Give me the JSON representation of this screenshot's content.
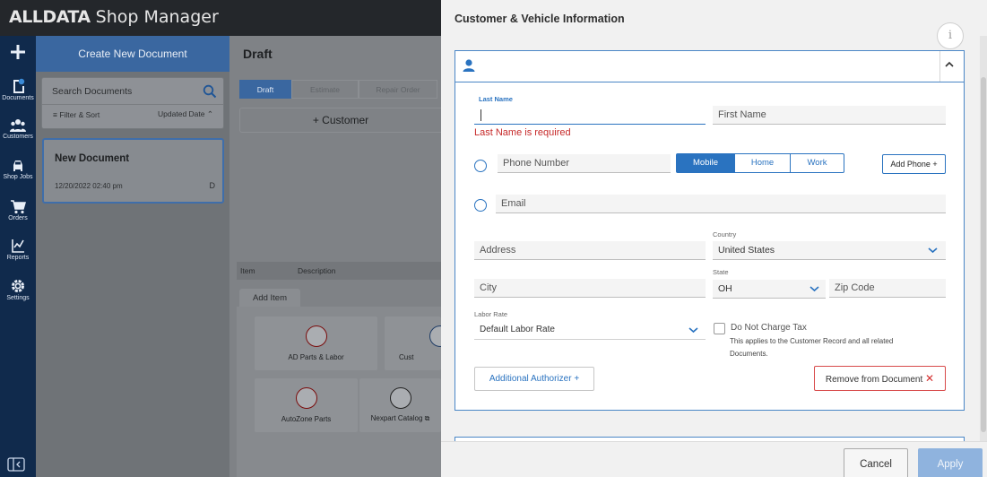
{
  "app": {
    "brand_bold": "ALLDATA",
    "brand_rest": " Shop Manager"
  },
  "nav": {
    "items": [
      {
        "label": "Documents",
        "icon": "documents-icon"
      },
      {
        "label": "Customers",
        "icon": "customers-icon"
      },
      {
        "label": "Shop Jobs",
        "icon": "car-icon"
      },
      {
        "label": "Orders",
        "icon": "cart-icon"
      },
      {
        "label": "Reports",
        "icon": "reports-icon"
      },
      {
        "label": "Settings",
        "icon": "gear-icon"
      }
    ]
  },
  "documents": {
    "create_label": "Create New Document",
    "search_placeholder": "Search Documents",
    "filter_label": "Filter & Sort",
    "sort_label": "Updated Date",
    "card": {
      "title": "New Document",
      "date": "12/20/2022 02:40 pm",
      "status": "D"
    }
  },
  "draft": {
    "title": "Draft",
    "tabs": [
      "Draft",
      "Estimate",
      "Repair Order"
    ],
    "customer_button": "Customer",
    "table_headers": [
      "Item",
      "Description"
    ],
    "add_item_tab": "Add Item",
    "tiles": [
      "AD Parts & Labor",
      "AutoZone Parts",
      "Nexpart Catalog",
      "Cust"
    ]
  },
  "panel": {
    "title": "Customer & Vehicle Information",
    "info_icon": "i",
    "last_name_label": "Last Name",
    "last_name_value": "",
    "first_name_placeholder": "First Name",
    "last_name_error": "Last Name is required",
    "phone_placeholder": "Phone Number",
    "phone_types": [
      "Mobile",
      "Home",
      "Work"
    ],
    "phone_type_selected": "Mobile",
    "add_phone": "Add Phone",
    "email_placeholder": "Email",
    "address_placeholder": "Address",
    "country_label": "Country",
    "country_value": "United States",
    "city_placeholder": "City",
    "state_label": "State",
    "state_value": "OH",
    "zip_placeholder": "Zip Code",
    "labor_rate_label": "Labor Rate",
    "labor_rate_value": "Default Labor Rate",
    "no_tax_label": "Do Not Charge Tax",
    "no_tax_checked": false,
    "no_tax_note_1": "This applies to the Customer Record and all related",
    "no_tax_note_2": "Documents.",
    "additional_authorizer": "Additional Authorizer",
    "remove_button": "Remove from Document",
    "cancel_button": "Cancel",
    "apply_button": "Apply"
  },
  "colors": {
    "primary": "#2a73c0",
    "error": "#c62828",
    "rail": "#102a4c",
    "remove_border": "#d84a4a"
  }
}
